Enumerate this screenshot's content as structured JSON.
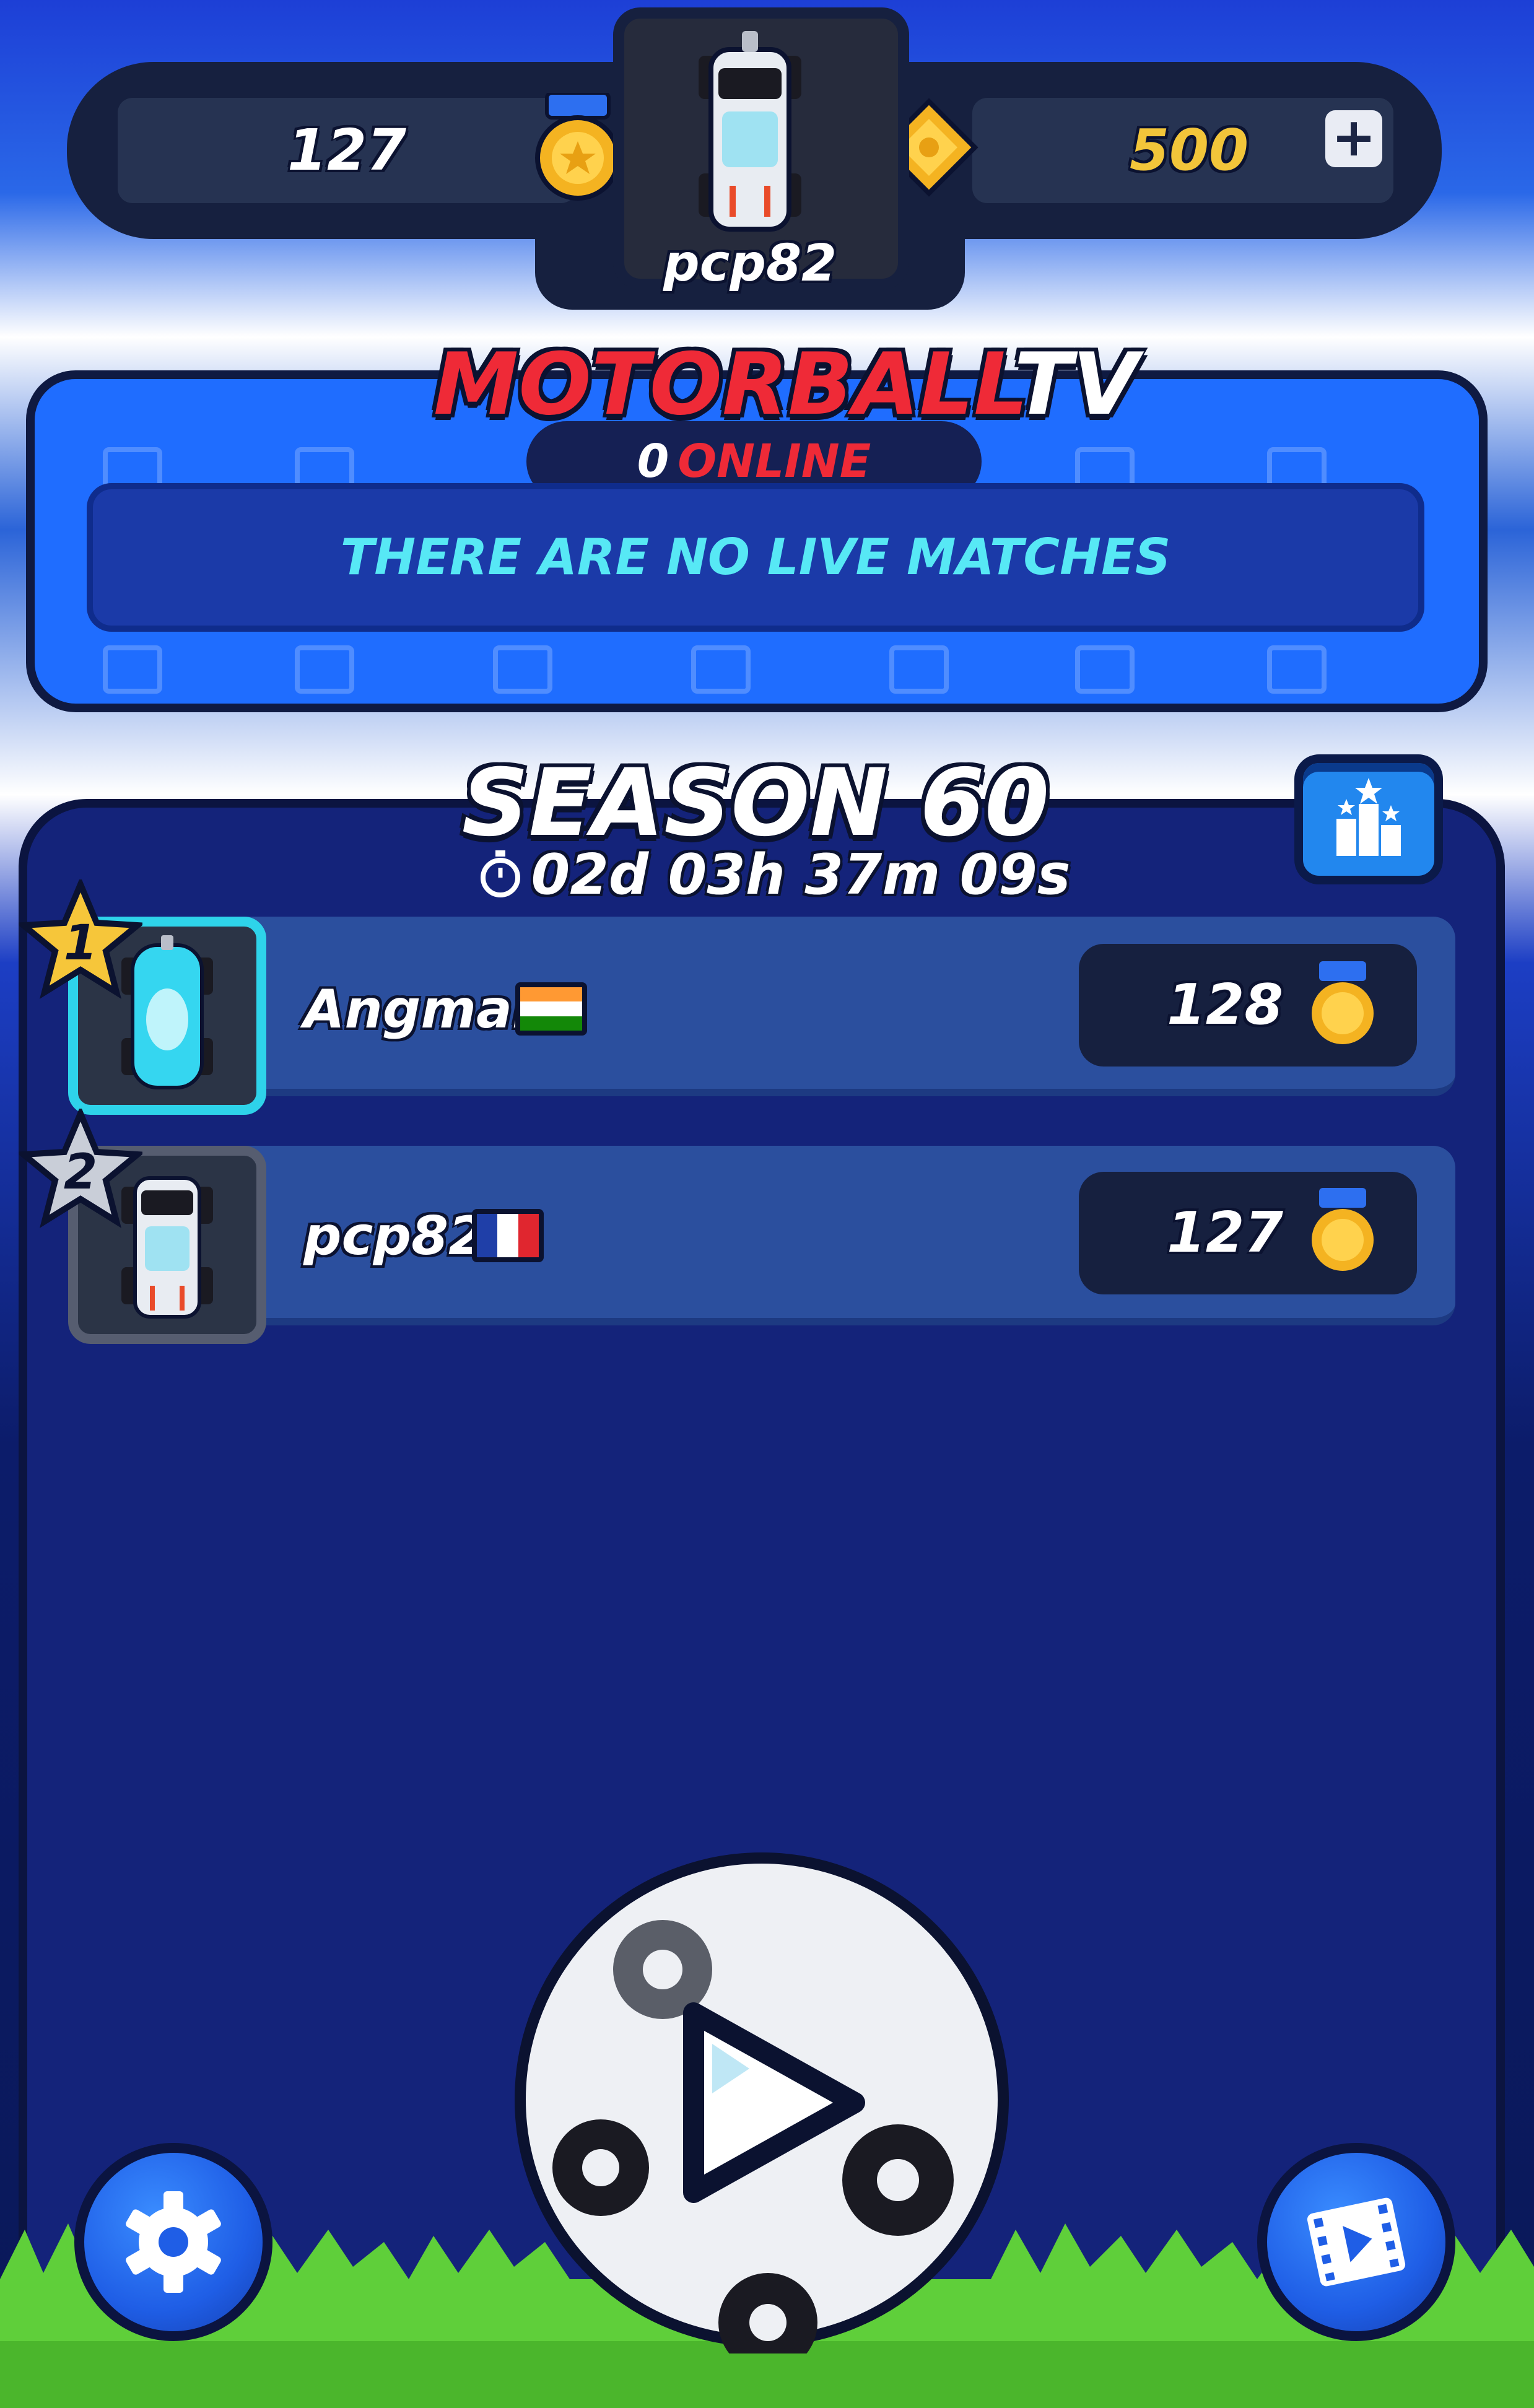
{
  "header": {
    "trophies": "127",
    "coins": "500",
    "add_coins_label": "+",
    "player_name": "pcp82"
  },
  "tv": {
    "title_motor": "MOTORBALL",
    "title_tv": "TV",
    "online_count": "0",
    "online_label": "ONLINE",
    "no_matches": "THERE ARE NO LIVE MATCHES"
  },
  "season": {
    "title": "SEASON 60",
    "timer": "02d 03h 37m 09s",
    "leaderboard": [
      {
        "rank": "1",
        "name": "Angmar",
        "country": "India",
        "score": "128"
      },
      {
        "rank": "2",
        "name": "pcp82",
        "country": "France",
        "score": "127"
      }
    ]
  },
  "icons": {
    "trophy": "medal-icon",
    "coin": "coin-icon",
    "timer": "stopwatch-icon",
    "leaderboard": "podium-icon",
    "play": "play-icon",
    "settings": "gear-icon",
    "videos": "film-icon"
  },
  "colors": {
    "accent_red": "#ef2a37",
    "coin_gold": "#f2c53a",
    "live_cyan": "#57e8f5",
    "panel_blue": "#1f6dff",
    "season_panel": "#14237a"
  }
}
